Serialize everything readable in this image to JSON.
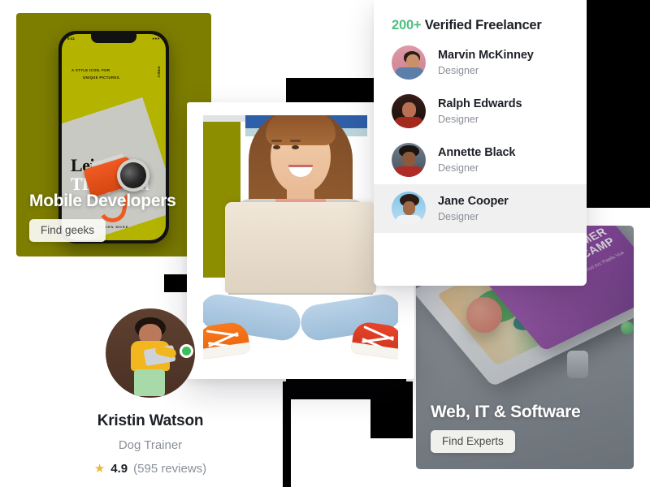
{
  "cards": {
    "mobile": {
      "title": "Mobile Developers",
      "button": "Find geeks",
      "phone": {
        "time": "9:41",
        "signal": "●●●",
        "copy_line1": "A STYLE ICON. FOR",
        "copy_line2": "UNIQUE PICTURES.",
        "side_label": "PREV",
        "title_line1": "Leica",
        "title_line2": "TL System",
        "learn_more": "LEARN MORE"
      },
      "bg_color": "#7d7d00"
    },
    "web": {
      "title": "Web, IT & Software",
      "button": "Find Experts",
      "illustration": {
        "headline_line1": "SUMMER",
        "headline_line2": "CAMP",
        "sub_text": "Rod Arc Papilu Vue"
      }
    }
  },
  "panel": {
    "heading_accent": "200+",
    "heading_rest": " Verified Freelancer",
    "freelancers": [
      {
        "name": "Marvin McKinney",
        "role": "Designer",
        "active": false
      },
      {
        "name": "Ralph Edwards",
        "role": "Designer",
        "active": false
      },
      {
        "name": "Annette Black",
        "role": "Designer",
        "active": false
      },
      {
        "name": "Jane Cooper",
        "role": "Designer",
        "active": true
      }
    ]
  },
  "profile": {
    "name": "Kristin Watson",
    "role": "Dog Trainer",
    "star_icon": "★",
    "score": "4.9",
    "reviews": "(595 reviews)",
    "online": true
  },
  "colors": {
    "accent_green": "#4ec07f",
    "olive": "#7d7d00",
    "star_gold": "#e8b93a",
    "text_dark": "#1d2026",
    "text_muted": "#8a8f98",
    "online_dot": "#3bbf5d"
  }
}
